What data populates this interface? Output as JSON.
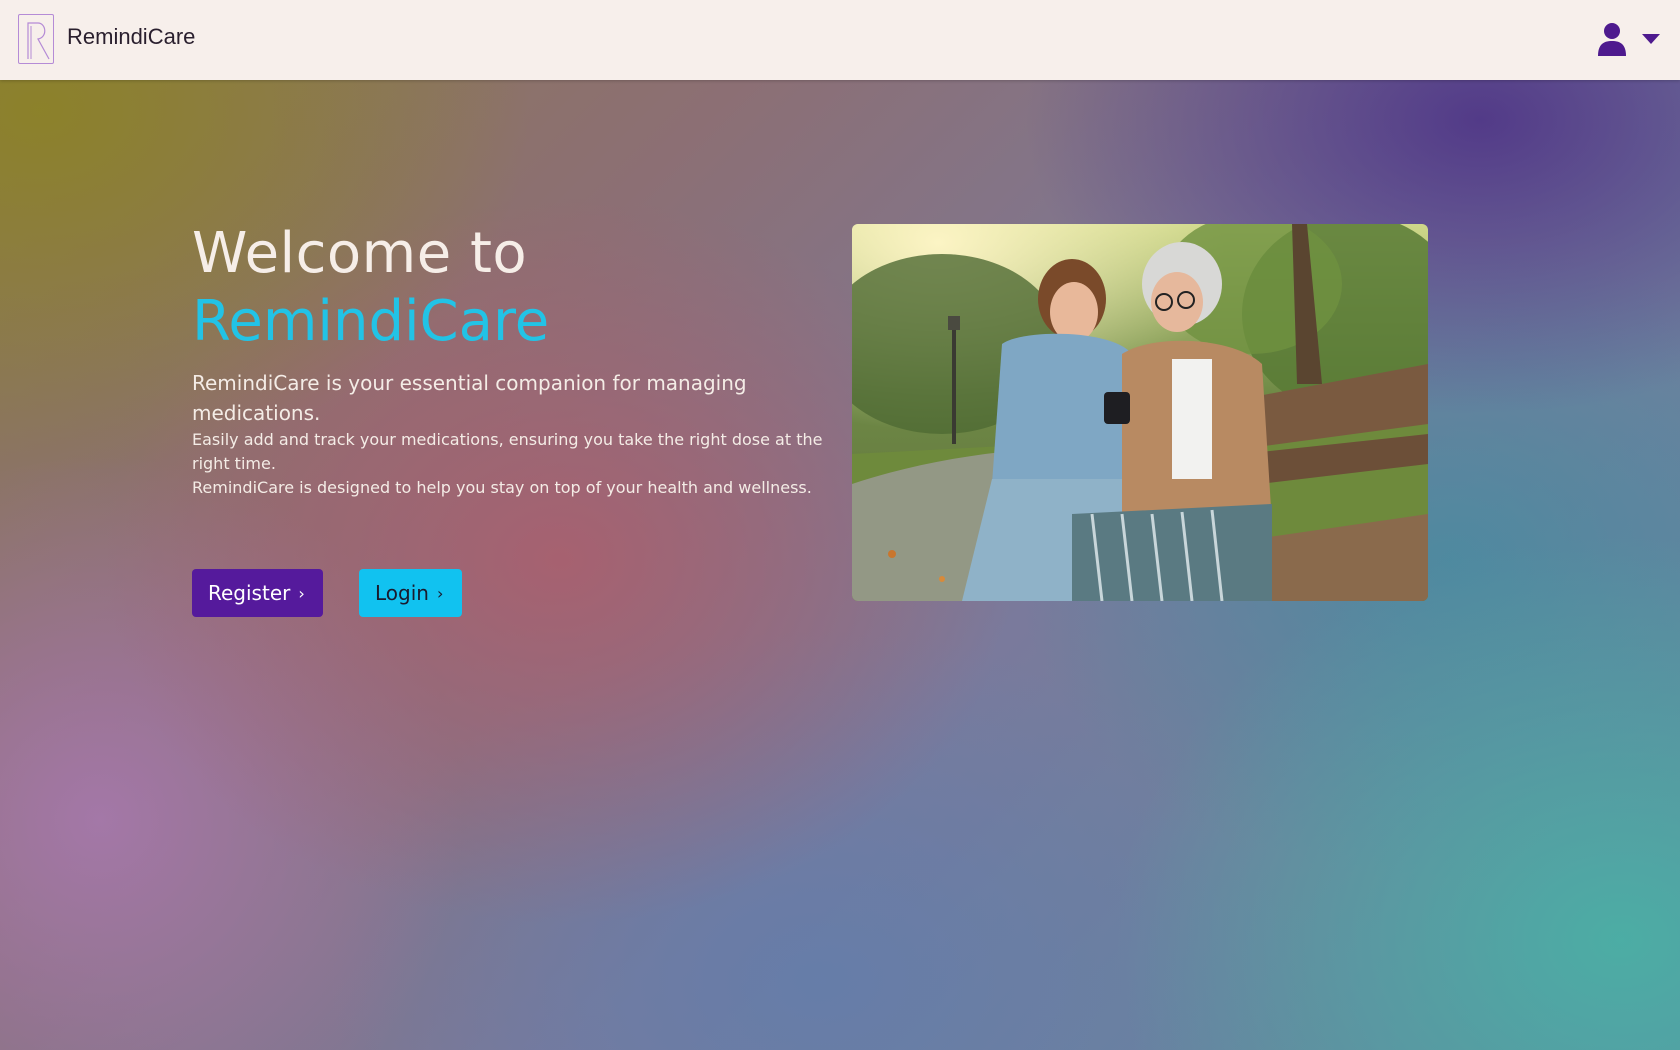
{
  "header": {
    "logo_icon": "letter-r-logo-icon",
    "brand": "RemindiCare",
    "user_icon": "user-icon",
    "caret_icon": "caret-down-icon",
    "accent": "#551a9c"
  },
  "hero": {
    "welcome": "Welcome to",
    "brand": "RemindiCare",
    "lead": "RemindiCare is your essential companion for managing medications.",
    "detail_1": "Easily add and track your medications, ensuring you take the right dose at the right time.",
    "detail_2": "RemindiCare is designed to help you stay on top of your health and wellness.",
    "register_label": "Register",
    "login_label": "Login",
    "chevron": "›",
    "register_color": "#551a9c",
    "login_color": "#11c2f0",
    "brand_color": "#22c3e6"
  },
  "image": {
    "alt": "Nurse showing an elderly woman a smartphone on a park bench"
  }
}
